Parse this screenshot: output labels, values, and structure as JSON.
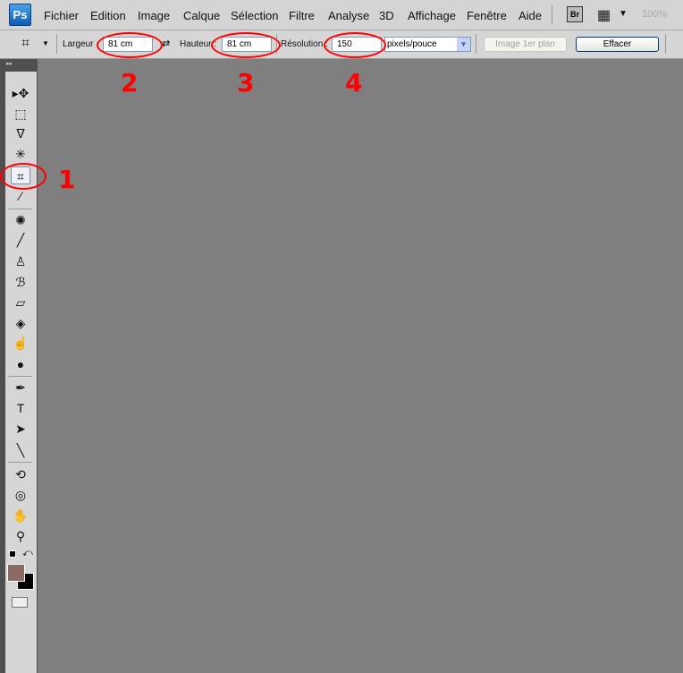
{
  "app": {
    "logo": "Ps",
    "zoom": "100%",
    "bridge": "Br"
  },
  "menu": [
    "Fichier",
    "Edition",
    "Image",
    "Calque",
    "Sélection",
    "Filtre",
    "Analyse",
    "3D",
    "Affichage",
    "Fenêtre",
    "Aide"
  ],
  "options": {
    "width_label": "Largeur",
    "width_value": "81 cm",
    "height_label": "Hauteur :",
    "height_value": "81 cm",
    "resolution_label": "Résolution :",
    "resolution_value": "150",
    "unit": "pixels/pouce",
    "front_image": "Image 1er plan",
    "clear": "Effacer"
  },
  "tools": [
    {
      "name": "move",
      "glyph": "▸✥"
    },
    {
      "name": "marquee",
      "glyph": "⬚"
    },
    {
      "name": "lasso",
      "glyph": "ᐁ"
    },
    {
      "name": "magic-wand",
      "glyph": "✳"
    },
    {
      "name": "crop",
      "glyph": "⌗",
      "selected": true
    },
    {
      "name": "eyedropper",
      "glyph": "⁄"
    },
    {
      "name": "healing",
      "glyph": "✺"
    },
    {
      "name": "brush",
      "glyph": "╱"
    },
    {
      "name": "stamp",
      "glyph": "♙"
    },
    {
      "name": "history-brush",
      "glyph": "ℬ"
    },
    {
      "name": "eraser",
      "glyph": "▱"
    },
    {
      "name": "bucket",
      "glyph": "◈"
    },
    {
      "name": "blur",
      "glyph": "☝"
    },
    {
      "name": "dodge",
      "glyph": "●"
    },
    {
      "name": "pen",
      "glyph": "✒"
    },
    {
      "name": "type",
      "glyph": "T"
    },
    {
      "name": "path-select",
      "glyph": "➤"
    },
    {
      "name": "line",
      "glyph": "╲"
    },
    {
      "name": "3d-rotate",
      "glyph": "⟲"
    },
    {
      "name": "3d-orbit",
      "glyph": "◎"
    },
    {
      "name": "hand",
      "glyph": "✋"
    },
    {
      "name": "zoom",
      "glyph": "⚲"
    }
  ],
  "colors": {
    "foreground": "#8c6a64",
    "background": "#000000",
    "canvas": "#7f7f7f"
  },
  "annotations": [
    "1",
    "2",
    "3",
    "4"
  ]
}
